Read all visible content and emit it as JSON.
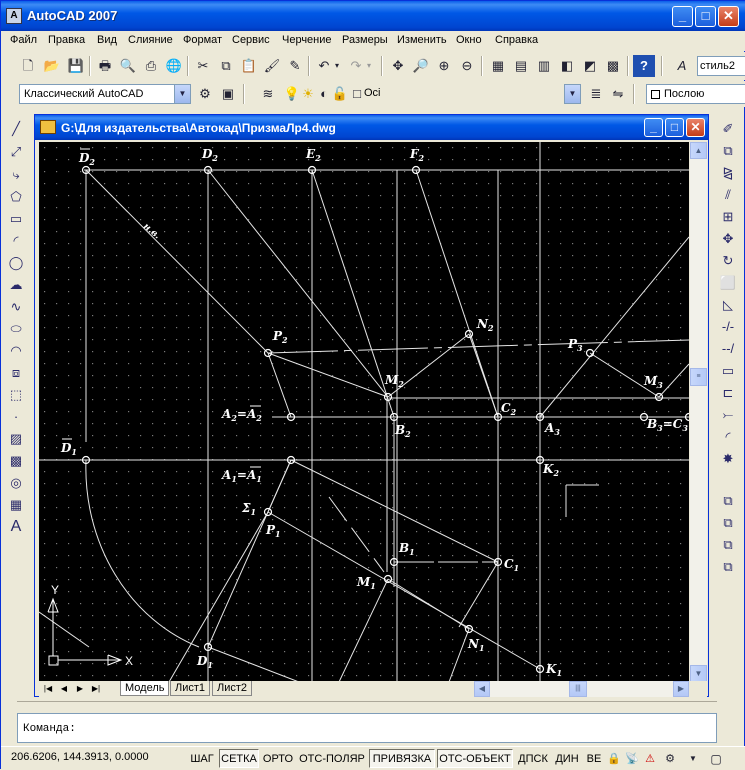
{
  "app": {
    "title": "AutoCAD 2007",
    "minimize": "_",
    "maximize": "□",
    "close": "✕"
  },
  "menu": [
    "Файл",
    "Правка",
    "Вид",
    "Слияние",
    "Формат",
    "Сервис",
    "Черчение",
    "Размеры",
    "Изменить",
    "Окно",
    "Справка"
  ],
  "toolbar": {
    "text_style": "стиль2",
    "workspace": "Классический AutoCAD",
    "layer": "Осі",
    "color_by": "Послою"
  },
  "document": {
    "title": "G:\\Для издательства\\Автокад\\ПризмаЛр4.dwg"
  },
  "tabs": [
    "Модель",
    "Лист1",
    "Лист2"
  ],
  "command": {
    "prompt": "Команда:"
  },
  "status": {
    "coords": "206.6206, 144.3913, 0.0000",
    "buttons": [
      "ШАГ",
      "СЕТКА",
      "ОРТО",
      "ОТС-ПОЛЯР",
      "ПРИВЯЗКА",
      "ОТС-ОБЪЕКТ",
      "ДПСК",
      "ДИН",
      "ВЕ"
    ]
  },
  "drawing": {
    "labels": {
      "d2bar": "D",
      "d2bar_sub": "2",
      "d2": "D",
      "d2_sub": "2",
      "e2": "E",
      "e2_sub": "2",
      "f2": "F",
      "f2_sub": "2",
      "nv": "н.в.",
      "p2": "P",
      "p2_sub": "2",
      "n2": "N",
      "n2_sub": "2",
      "p3": "P",
      "p3_sub": "3",
      "m2": "M",
      "m2_sub": "2",
      "m3": "M",
      "m3_sub": "3",
      "a2": "A",
      "a2_sub": "2",
      "a2eq": "=A",
      "a2eq_sub": "2",
      "c2": "C",
      "c2_sub": "2",
      "b2": "B",
      "b2_sub": "2",
      "a3": "A",
      "a3_sub": "3",
      "b3c3": "B",
      "b3c3_sub": "3",
      "b3c3_eq": "=C",
      "b3c3_eq_sub": "3",
      "d1bar": "D",
      "d1bar_sub": "1",
      "a1": "A",
      "a1_sub": "1",
      "a1eq": "=A",
      "a1eq_sub": "1",
      "k2": "K",
      "k2_sub": "2",
      "sigma": "Σ",
      "sigma_sub": "1",
      "p1": "P",
      "p1_sub": "1",
      "b1": "B",
      "b1_sub": "1",
      "c1": "C",
      "c1_sub": "1",
      "m1": "M",
      "m1_sub": "1",
      "n1": "N",
      "n1_sub": "1",
      "d1": "D",
      "d1_sub": "1",
      "k1": "K",
      "k1_sub": "1",
      "ucs_y": "Y",
      "ucs_x": "X"
    }
  }
}
